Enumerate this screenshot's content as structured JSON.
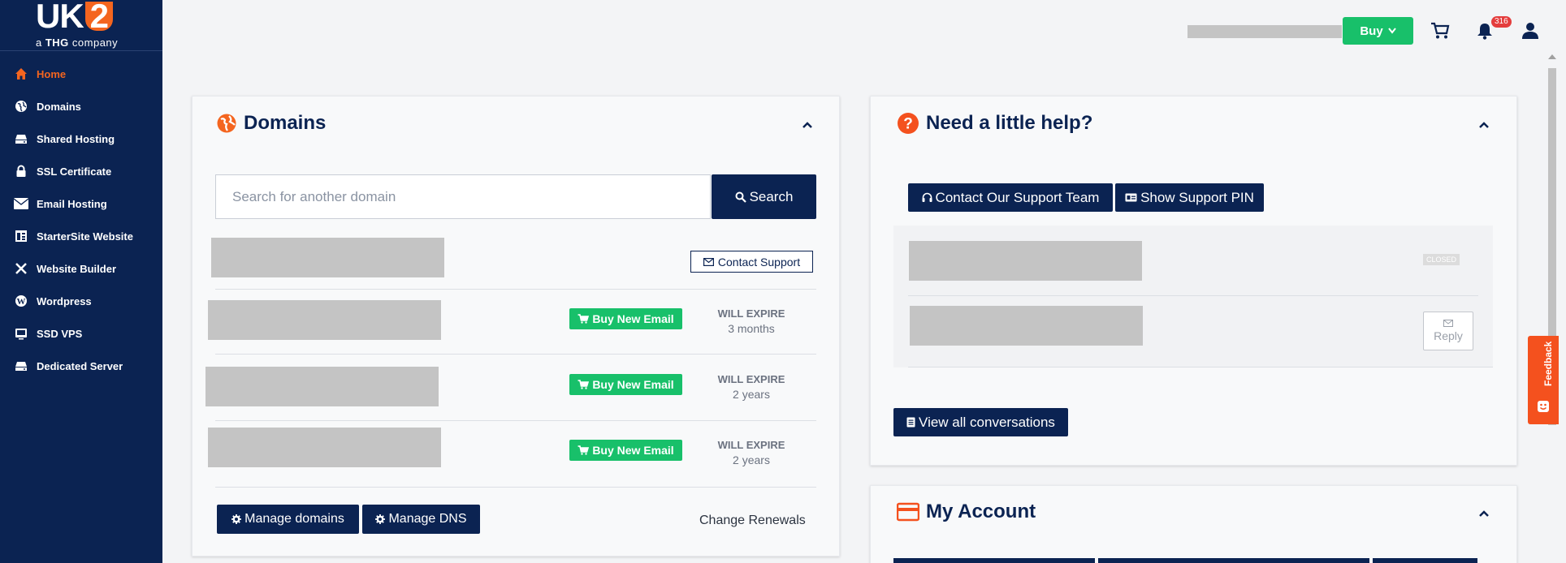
{
  "logo": {
    "brand": "UK",
    "brand_num": "2",
    "tagline_prefix": "a ",
    "tagline_bold": "THG",
    "tagline_suffix": " company"
  },
  "sidebar": {
    "items": [
      {
        "label": "Home",
        "icon": "home-icon",
        "active": true
      },
      {
        "label": "Domains",
        "icon": "globe-icon"
      },
      {
        "label": "Shared Hosting",
        "icon": "server-icon"
      },
      {
        "label": "SSL Certificate",
        "icon": "lock-icon"
      },
      {
        "label": "Email Hosting",
        "icon": "envelope-icon"
      },
      {
        "label": "StarterSite Website",
        "icon": "layout-icon"
      },
      {
        "label": "Website Builder",
        "icon": "tools-icon"
      },
      {
        "label": "Wordpress",
        "icon": "wordpress-icon"
      },
      {
        "label": "SSD VPS",
        "icon": "monitor-icon"
      },
      {
        "label": "Dedicated Server",
        "icon": "server-icon"
      }
    ]
  },
  "topbar": {
    "buy_label": "Buy",
    "notification_count": "316"
  },
  "domains": {
    "title": "Domains",
    "search_placeholder": "Search for another domain",
    "search_label": "Search",
    "contact_support_label": "Contact Support",
    "rows": [
      {
        "button": "Buy New Email",
        "expire_label": "WILL EXPIRE",
        "expire_value": "3 months"
      },
      {
        "button": "Buy New Email",
        "expire_label": "WILL EXPIRE",
        "expire_value": "2 years"
      },
      {
        "button": "Buy New Email",
        "expire_label": "WILL EXPIRE",
        "expire_value": "2 years"
      }
    ],
    "manage_domains_label": "Manage domains",
    "manage_dns_label": "Manage DNS",
    "change_renewals_label": "Change Renewals"
  },
  "help": {
    "title": "Need a little help?",
    "contact_team_label": "Contact Our Support Team",
    "show_pin_label": "Show Support PIN",
    "closed_badge": "CLOSED",
    "reply_label": "Reply",
    "view_all_label": "View all conversations"
  },
  "account": {
    "title": "My Account"
  },
  "feedback_label": "Feedback",
  "colors": {
    "navy": "#0b2352",
    "green": "#18c06a",
    "orange": "#f4651f"
  }
}
